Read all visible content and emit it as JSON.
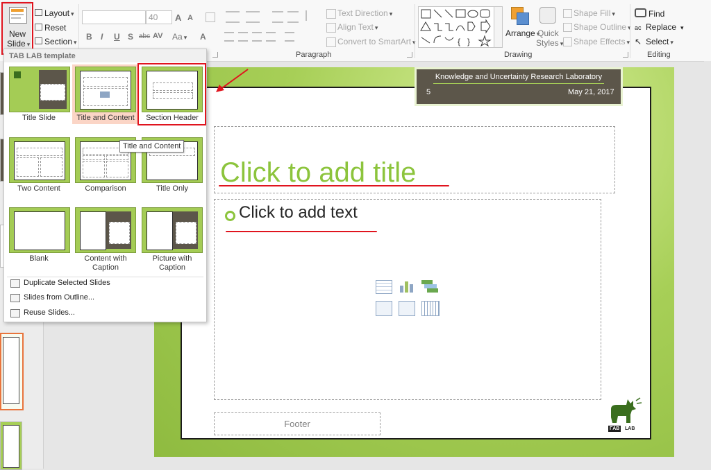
{
  "ribbon": {
    "new_slide_label_1": "New",
    "new_slide_label_2": "Slide",
    "layout": "Layout",
    "reset": "Reset",
    "section": "Section",
    "font_size": "40",
    "bold": "B",
    "italic": "I",
    "underline": "U",
    "shadow": "S",
    "strike": "abc",
    "spacing": "AV",
    "case": "Aa",
    "font_color": "A",
    "grow": "A",
    "shrink": "A",
    "text_direction": "Text Direction",
    "align_text": "Align Text",
    "convert_smartart": "Convert to SmartArt",
    "paragraph": "Paragraph",
    "arrange": "Arrange",
    "quick_styles_1": "Quick",
    "quick_styles_2": "Styles",
    "shape_fill": "Shape Fill",
    "shape_outline": "Shape Outline",
    "shape_effects": "Shape Effects",
    "drawing": "Drawing",
    "find": "Find",
    "replace": "Replace",
    "select": "Select",
    "editing": "Editing"
  },
  "gallery": {
    "theme_name": "TAB LAB template",
    "layouts": [
      {
        "label": "Title Slide"
      },
      {
        "label": "Title and Content"
      },
      {
        "label": "Section Header"
      },
      {
        "label": "Two Content"
      },
      {
        "label": "Comparison"
      },
      {
        "label": "Title Only"
      },
      {
        "label": "Blank"
      },
      {
        "label": "Content with\nCaption"
      },
      {
        "label": "Picture with\nCaption"
      }
    ],
    "tooltip": "Title and Content",
    "menu": [
      {
        "label": "Duplicate Selected Slides"
      },
      {
        "label": "Slides from Outline..."
      },
      {
        "label": "Reuse Slides..."
      }
    ]
  },
  "slide": {
    "header_org": "Knowledge and Uncertainty Research Laboratory",
    "slide_number": "5",
    "date": "May 21, 2017",
    "title_placeholder": "Click to add title",
    "text_placeholder": "Click to add text",
    "footer": "Footer",
    "logo_text_left": "ΓAB",
    "logo_text_right": "LAB"
  },
  "colors": {
    "accent_green": "#8cc43c",
    "slide_green": "#a7cf57",
    "header_brown": "#5c564a",
    "annotation_red": "#e0141e"
  }
}
